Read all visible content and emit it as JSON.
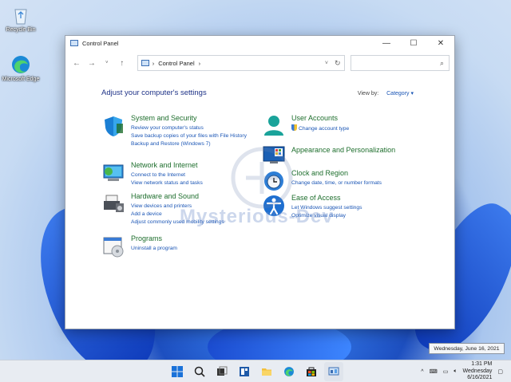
{
  "desktop": {
    "icons": [
      {
        "label": "Recycle Bin",
        "icon": "recycle-bin-icon"
      },
      {
        "label": "Microsoft Edge",
        "icon": "edge-icon"
      }
    ]
  },
  "window": {
    "title": "Control Panel",
    "controls": {
      "minimize": "—",
      "maximize": "☐",
      "close": "✕"
    },
    "address": {
      "crumb": "Control Panel",
      "separator": "›"
    },
    "heading": "Adjust your computer's settings",
    "view_by_label": "View by:",
    "view_by_value": "Category",
    "categories": [
      {
        "title": "System and Security",
        "icon": "shield-icon",
        "links": [
          "Review your computer's status",
          "Save backup copies of your files with File History",
          "Backup and Restore (Windows 7)"
        ]
      },
      {
        "title": "Network and Internet",
        "icon": "network-icon",
        "links": [
          "Connect to the Internet",
          "View network status and tasks"
        ]
      },
      {
        "title": "Hardware and Sound",
        "icon": "printer-icon",
        "links": [
          "View devices and printers",
          "Add a device",
          "Adjust commonly used mobility settings"
        ]
      },
      {
        "title": "Programs",
        "icon": "programs-icon",
        "links": [
          "Uninstall a program"
        ]
      },
      {
        "title": "User Accounts",
        "icon": "user-icon",
        "links": [
          "Change account type"
        ]
      },
      {
        "title": "Appearance and Personalization",
        "icon": "appearance-icon",
        "links": []
      },
      {
        "title": "Clock and Region",
        "icon": "clock-icon",
        "links": [
          "Change date, time, or number formats"
        ]
      },
      {
        "title": "Ease of Access",
        "icon": "accessibility-icon",
        "links": [
          "Let Windows suggest settings",
          "Optimize visual display"
        ]
      }
    ]
  },
  "watermark": "Mysterious-Dev",
  "taskbar": {
    "apps": [
      "windows-start-icon",
      "search-icon",
      "task-view-icon",
      "widgets-icon",
      "file-explorer-icon",
      "edge-icon",
      "store-icon",
      "control-panel-icon"
    ],
    "tray": {
      "chevron": "^",
      "time": "1:31 PM",
      "day": "Wednesday",
      "date": "6/16/2021"
    },
    "date_tooltip": "Wednesday, June 16, 2021"
  },
  "colors": {
    "link": "#1a55b5",
    "category_title": "#1e6e2d",
    "heading": "#1e3287"
  }
}
